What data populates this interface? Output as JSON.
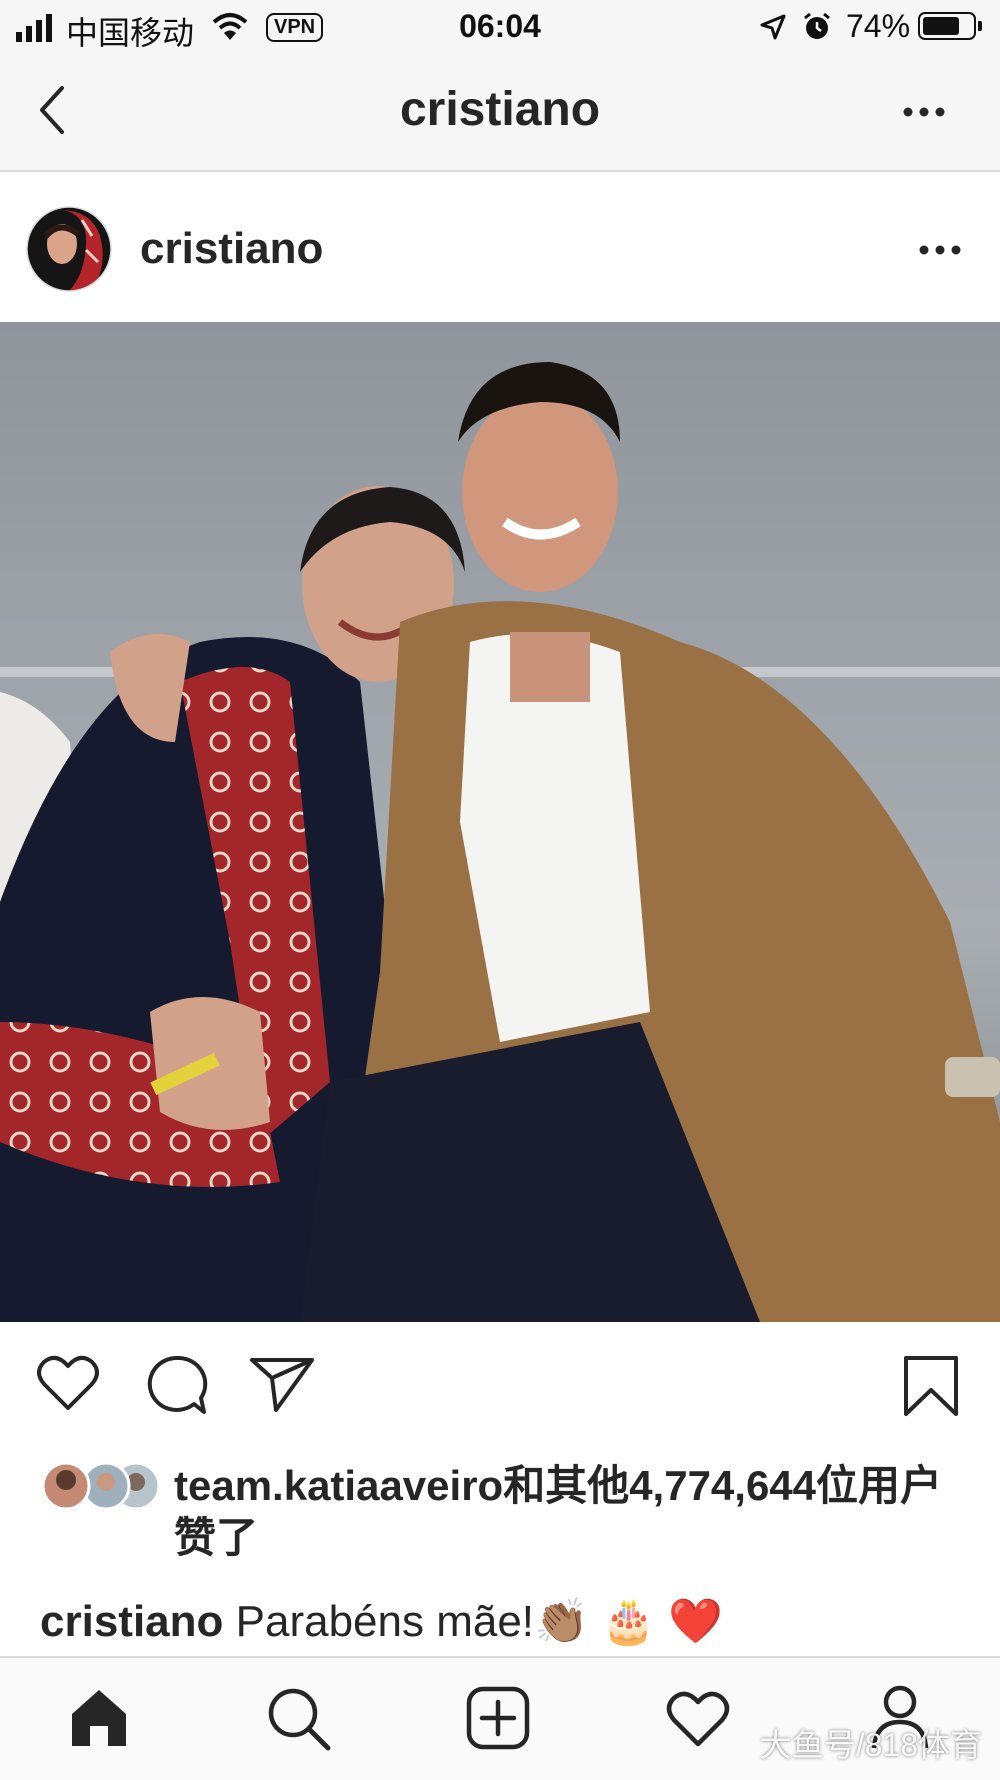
{
  "status_bar": {
    "carrier": "中国移动",
    "vpn": "VPN",
    "time": "06:04",
    "battery": "74%",
    "battery_level": 0.74
  },
  "nav": {
    "title": "cristiano"
  },
  "post": {
    "username": "cristiano",
    "likes_text": "team.katiaaveiro和其他4,774,644位用户赞了",
    "caption_user": "cristiano",
    "caption_text": "Parabéns mãe!👏🏽 🎂 ❤️"
  },
  "watermark": "大鱼号/818体育",
  "colors": {
    "text": "#262626",
    "bar_bg": "#f6f6f6",
    "divider": "#dbdbdb",
    "heart_red": "#e0245e"
  },
  "icons": {
    "back": "chevron-left-icon",
    "more": "more-horizontal-icon",
    "like": "heart-icon",
    "comment": "comment-bubble-icon",
    "share": "paper-plane-icon",
    "save": "bookmark-icon",
    "home": "home-icon",
    "search": "search-icon",
    "add": "add-post-icon",
    "activity": "heart-icon",
    "profile": "profile-icon"
  }
}
